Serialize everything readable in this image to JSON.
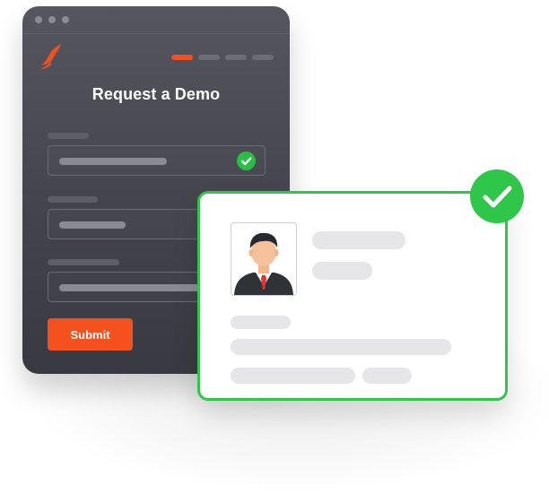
{
  "form": {
    "title": "Request a Demo",
    "submit_label": "Submit",
    "steps_total": 4,
    "steps_active": 1,
    "fields_total": 3,
    "fields_validated": 1
  },
  "colors": {
    "accent": "#f4511e",
    "success": "#2ec74a",
    "window_bg": "#4a4b53",
    "card_bg": "#ffffff"
  },
  "icons": {
    "brand_logo": "flame-logo",
    "field_check": "check-circle-icon",
    "card_check": "check-circle-icon",
    "profile": "person-avatar-icon"
  },
  "card": {
    "status": "verified"
  }
}
